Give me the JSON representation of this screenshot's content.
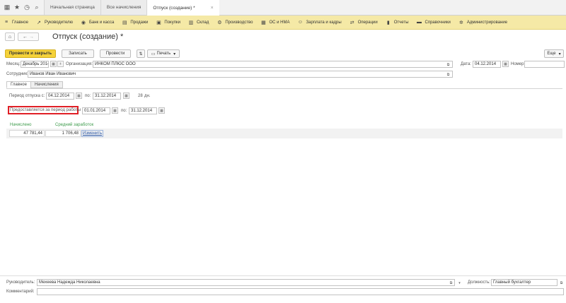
{
  "tabs": [
    {
      "label": "Начальная страница"
    },
    {
      "label": "Все начисления"
    },
    {
      "label": "Отпуск (создание) *",
      "close": "×"
    }
  ],
  "menu": [
    {
      "label": "Главное",
      "icon": "menu-icon"
    },
    {
      "label": "Руководителю",
      "icon": "chart-icon"
    },
    {
      "label": "Банк и касса",
      "icon": "bank-icon"
    },
    {
      "label": "Продажи",
      "icon": "sales-icon"
    },
    {
      "label": "Покупки",
      "icon": "cart-icon"
    },
    {
      "label": "Склад",
      "icon": "warehouse-icon"
    },
    {
      "label": "Производство",
      "icon": "factory-icon"
    },
    {
      "label": "ОС и НМА",
      "icon": "assets-icon"
    },
    {
      "label": "Зарплата и кадры",
      "icon": "people-icon"
    },
    {
      "label": "Операции",
      "icon": "ops-icon"
    },
    {
      "label": "Отчеты",
      "icon": "reports-icon"
    },
    {
      "label": "Справочники",
      "icon": "book-icon"
    },
    {
      "label": "Администрирование",
      "icon": "gear-icon"
    }
  ],
  "title": "Отпуск (создание) *",
  "toolbar": {
    "post_close": "Провести и закрыть",
    "save": "Записать",
    "post": "Провести",
    "print": "Печать",
    "more": "Еще"
  },
  "header": {
    "month_label": "Месяц:",
    "month_value": "Декабрь 2014",
    "org_label": "Организация:",
    "org_value": "ИНКОМ ПЛЮС ООО",
    "date_label": "Дата:",
    "date_value": "04.12.2014",
    "number_label": "Номер:",
    "number_value": "",
    "employee_label": "Сотрудник:",
    "employee_value": "Иванов Иван Иванович"
  },
  "subtabs": [
    "Главное",
    "Начисления"
  ],
  "main": {
    "period_label": "Период отпуска с:",
    "period_from": "04.12.2014",
    "to_label": "по:",
    "period_to": "31.12.2014",
    "days_value": "28",
    "days_unit": "дн.",
    "work_period_label": "Предоставляется за период работы с:",
    "work_from": "01.01.2014",
    "work_to": "31.12.2014",
    "accrued_header": "Начислено",
    "avg_header": "Средний заработок",
    "accrued_value": "47 781,44",
    "avg_value": "1 706,48",
    "change_link": "Изменить"
  },
  "footer": {
    "head_label": "Руководитель:",
    "head_value": "Мехеева Надежда Николаевна",
    "position_label": "Должность:",
    "position_value": "Главный бухгалтер",
    "comment_label": "Комментарий:",
    "comment_value": ""
  },
  "colors": {
    "menu_bg": "#f5e9a6",
    "primary_button": "#f5d23a",
    "highlight": "#e01f26",
    "accent_green": "#3d9b4b"
  }
}
